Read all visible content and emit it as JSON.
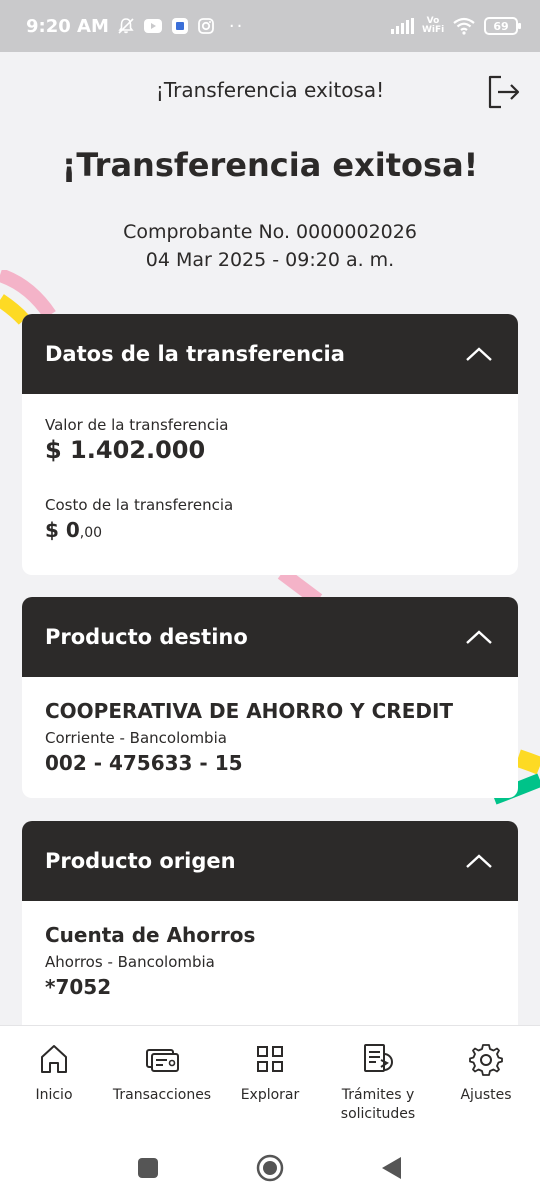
{
  "status_bar": {
    "time": "9:20 AM",
    "network_label": "Vo WiFi",
    "battery": "69"
  },
  "header": {
    "title": "¡Transferencia exitosa!"
  },
  "main": {
    "title": "¡Transferencia exitosa!",
    "receipt": "Comprobante No. 0000002026",
    "datetime": "04 Mar 2025 - 09:20 a. m."
  },
  "transfer_card": {
    "title": "Datos de la transferencia",
    "value_label": "Valor de la transferencia",
    "value_amount": "$ 1.402.000",
    "cost_label": "Costo de la transferencia",
    "cost_amount": "$ 0",
    "cost_decimals": ",00"
  },
  "destination_card": {
    "title": "Producto destino",
    "name": "COOPERATIVA DE AHORRO Y CREDIT",
    "type": "Corriente - Bancolombia",
    "number": "002 - 475633 - 15"
  },
  "origin_card": {
    "title": "Producto origen",
    "name": "Cuenta de Ahorros",
    "type": "Ahorros - Bancolombia",
    "number": "*7052"
  },
  "bottom_nav": {
    "items": [
      {
        "label": "Inicio",
        "icon": "home-icon"
      },
      {
        "label": "Transacciones",
        "icon": "transactions-icon"
      },
      {
        "label": "Explorar",
        "icon": "grid-icon"
      },
      {
        "label": "Trámites y solicitudes",
        "icon": "documents-icon"
      },
      {
        "label": "Ajustes",
        "icon": "gear-icon"
      }
    ]
  },
  "colors": {
    "dark": "#2c2a29",
    "background": "#f2f2f4",
    "yellow": "#fdda24",
    "pink": "#f4b3c8",
    "green": "#00c389"
  }
}
